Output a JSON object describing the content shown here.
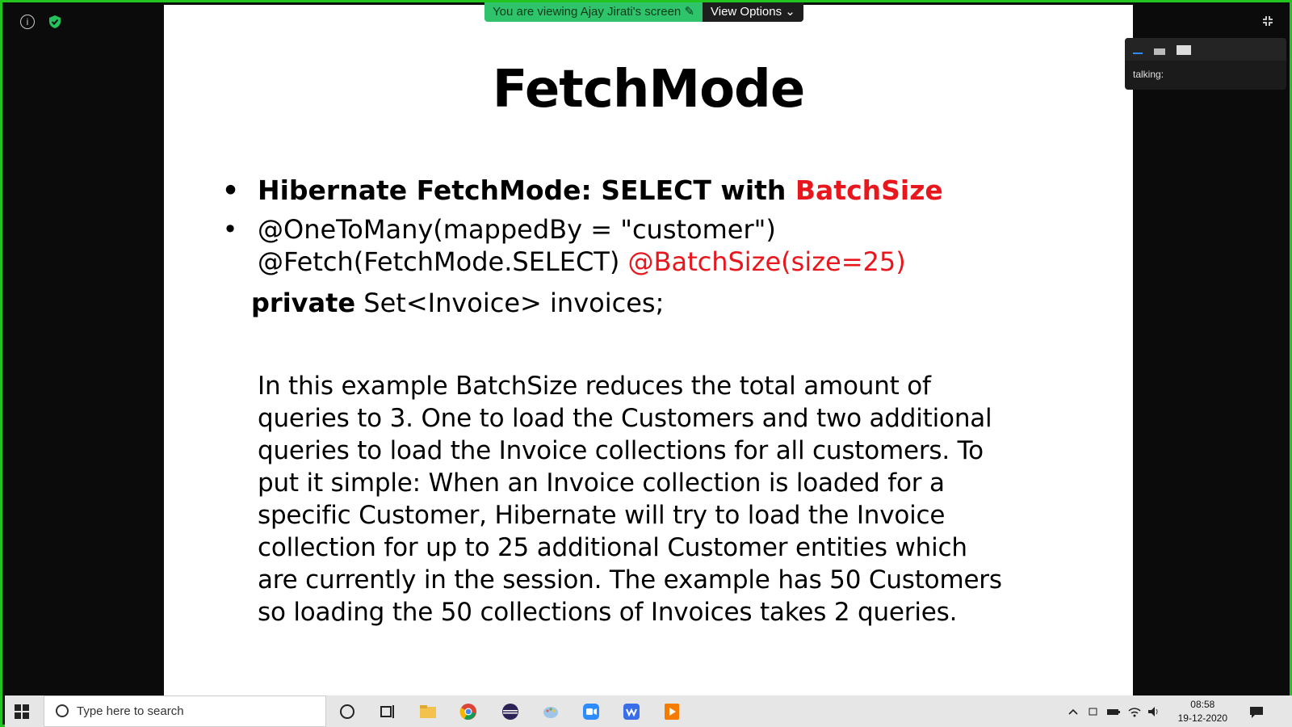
{
  "banner": {
    "viewing_text": "You are viewing Ajay Jirati's screen",
    "view_options_label": "View Options"
  },
  "slide": {
    "title": "FetchMode",
    "bullet1_black": "Hibernate FetchMode: SELECT with ",
    "bullet1_red": "BatchSize",
    "bullet2_line1": "@OneToMany(mappedBy = \"customer\")",
    "bullet2_line2_black": "@Fetch(FetchMode.SELECT) ",
    "bullet2_line2_red": "@BatchSize(size=25)",
    "line3_bold": "private",
    "line3_rest": " Set<Invoice> invoices;",
    "paragraph": "In this example BatchSize reduces the total amount of\nqueries to 3. One to load the Customers and two additional\nqueries to load the Invoice collections for all customers. To\nput it simple: When an Invoice collection is loaded for a\nspecific Customer, Hibernate will try to load the Invoice\ncollection for up to 25 additional Customer entities which\nare currently in the session. The example has 50 Customers\nso loading the 50 collections of Invoices takes 2 queries."
  },
  "talk_panel": {
    "label": "talking:"
  },
  "taskbar": {
    "search_placeholder": "Type here to search",
    "time": "08:58",
    "date": "19-12-2020"
  },
  "colors": {
    "frame_border": "#22c51e",
    "accent_red": "#e8171d",
    "banner_green": "#2fc36b"
  }
}
